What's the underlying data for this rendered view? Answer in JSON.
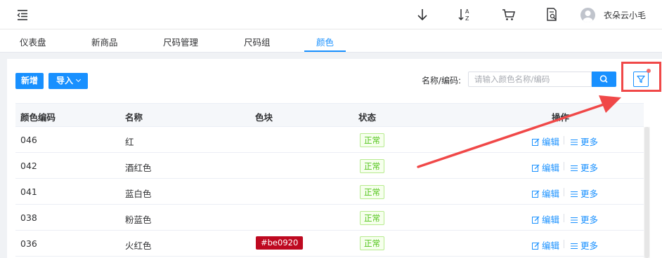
{
  "topbar": {
    "menu_toggle_icon": "menu-fold-icon",
    "icons": [
      "download-icon",
      "sort-az-icon",
      "cart-icon",
      "document-search-icon"
    ],
    "username": "衣朵云小毛"
  },
  "tabs": [
    {
      "label": "仪表盘",
      "active": false
    },
    {
      "label": "新商品",
      "active": false
    },
    {
      "label": "尺码管理",
      "active": false
    },
    {
      "label": "尺码组",
      "active": false
    },
    {
      "label": "颜色",
      "active": true
    }
  ],
  "toolbar": {
    "new_label": "新增",
    "import_label": "导入"
  },
  "search": {
    "label": "名称/编码:",
    "placeholder": "请输入颜色名称/编码",
    "value": ""
  },
  "table": {
    "columns": [
      "颜色编码",
      "名称",
      "色块",
      "状态",
      "操作"
    ],
    "rows": [
      {
        "code": "046",
        "name": "红",
        "swatch": "",
        "swatch_color": "",
        "status": "正常"
      },
      {
        "code": "042",
        "name": "酒红色",
        "swatch": "",
        "swatch_color": "",
        "status": "正常"
      },
      {
        "code": "041",
        "name": "蓝白色",
        "swatch": "",
        "swatch_color": "",
        "status": "正常"
      },
      {
        "code": "038",
        "name": "粉蓝色",
        "swatch": "",
        "swatch_color": "",
        "status": "正常"
      },
      {
        "code": "036",
        "name": "火红色",
        "swatch": "#be0920",
        "swatch_color": "#be0920",
        "status": "正常"
      }
    ],
    "edit_label": "编辑",
    "more_label": "更多"
  },
  "colors": {
    "primary": "#1890ff",
    "success": "#52c41a",
    "annotation": "#f04848"
  }
}
